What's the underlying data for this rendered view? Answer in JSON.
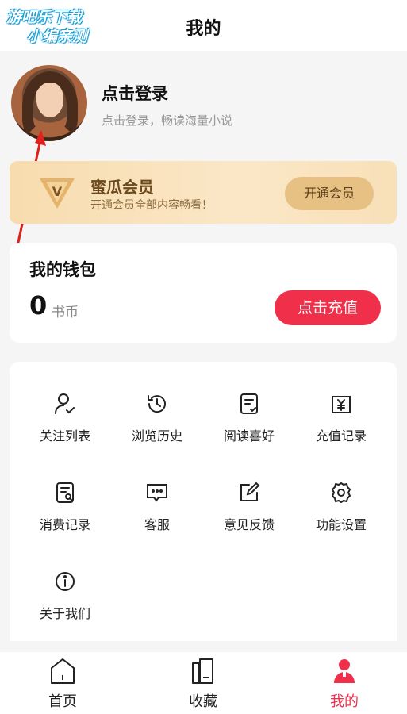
{
  "watermark": {
    "line1": "游吧乐下载",
    "line2": "小编亲测"
  },
  "header": {
    "title": "我的"
  },
  "profile": {
    "avatar_icon": "user-avatar-photo",
    "login_title": "点击登录",
    "login_subtitle": "点击登录，畅读海量小说"
  },
  "vip": {
    "icon": "vip-crown-icon",
    "title": "蜜瓜会员",
    "subtitle": "开通会员全部内容畅看！",
    "button_label": "开通会员"
  },
  "wallet": {
    "title": "我的钱包",
    "amount": "0",
    "unit": "书币",
    "recharge_label": "点击充值"
  },
  "menu": {
    "items": [
      {
        "label": "关注列表",
        "icon": "follow-user-icon"
      },
      {
        "label": "浏览历史",
        "icon": "history-clock-icon"
      },
      {
        "label": "阅读喜好",
        "icon": "reading-preference-icon"
      },
      {
        "label": "充值记录",
        "icon": "recharge-record-icon"
      },
      {
        "label": "消费记录",
        "icon": "consumption-record-icon"
      },
      {
        "label": "客服",
        "icon": "customer-service-icon"
      },
      {
        "label": "意见反馈",
        "icon": "feedback-edit-icon"
      },
      {
        "label": "功能设置",
        "icon": "settings-gear-icon"
      },
      {
        "label": "关于我们",
        "icon": "info-icon"
      }
    ]
  },
  "tabbar": {
    "items": [
      {
        "label": "首页",
        "icon": "home-icon",
        "active": false
      },
      {
        "label": "收藏",
        "icon": "bookshelf-icon",
        "active": false
      },
      {
        "label": "我的",
        "icon": "profile-icon",
        "active": true
      }
    ]
  },
  "colors": {
    "accent_red": "#f0304a",
    "vip_gold": "#e7c083",
    "annotation_arrow": "#e0201c"
  }
}
